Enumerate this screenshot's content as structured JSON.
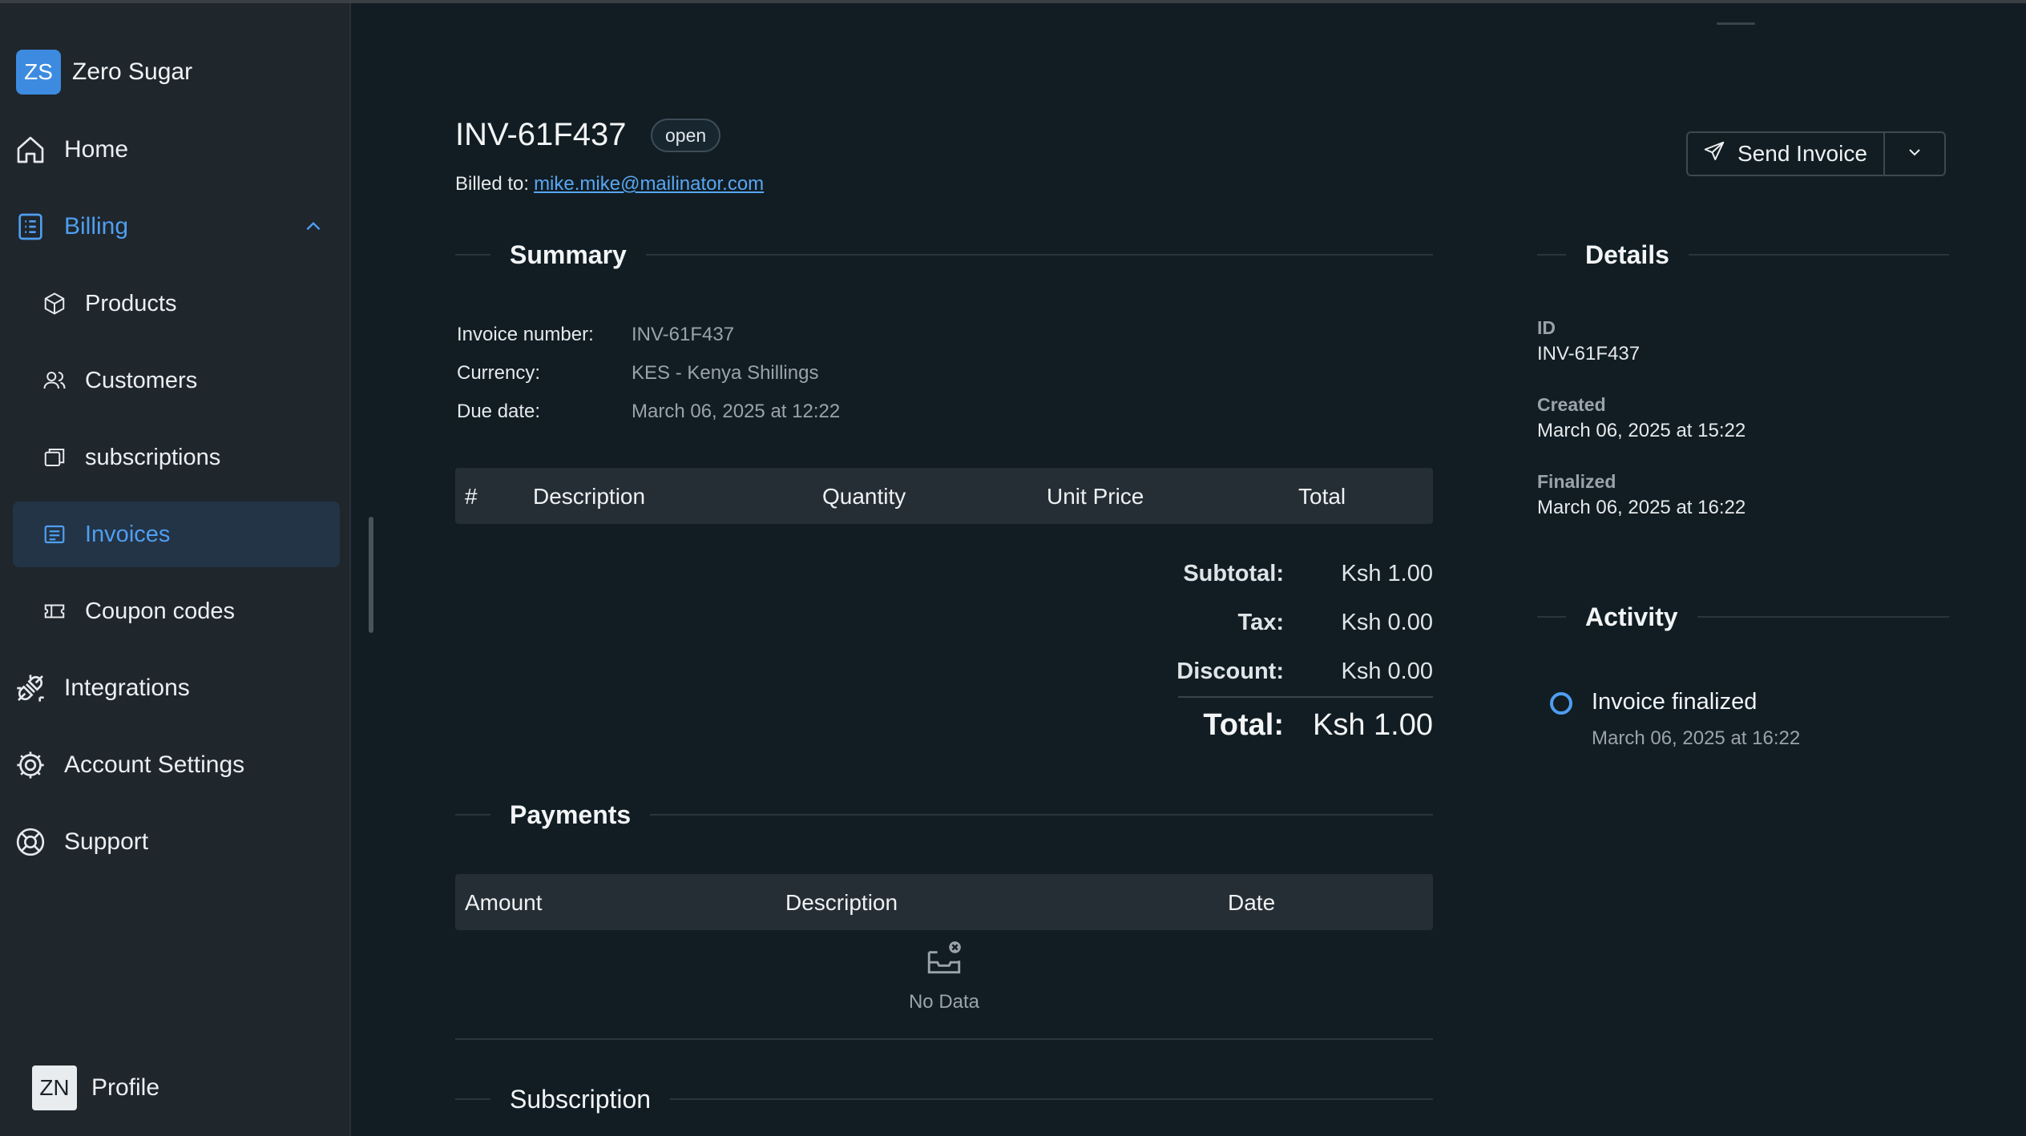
{
  "org": {
    "initials": "ZS",
    "name": "Zero Sugar"
  },
  "nav": {
    "home": "Home",
    "billing": "Billing",
    "billing_children": {
      "products": "Products",
      "customers": "Customers",
      "subscriptions": "subscriptions",
      "invoices": "Invoices",
      "coupon_codes": "Coupon codes"
    },
    "integrations": "Integrations",
    "account_settings": "Account Settings",
    "support": "Support"
  },
  "profile": {
    "initials": "ZN",
    "label": "Profile"
  },
  "invoice": {
    "title": "INV-61F437",
    "status": "open",
    "billed_to_label": "Billed to:",
    "billed_to_email": "mike.mike@mailinator.com"
  },
  "actions": {
    "send_invoice": "Send Invoice"
  },
  "summary": {
    "heading": "Summary",
    "fields": [
      {
        "label": "Invoice number:",
        "value": "INV-61F437"
      },
      {
        "label": "Currency:",
        "value": "KES - Kenya Shillings"
      },
      {
        "label": "Due date:",
        "value": "March 06, 2025 at 12:22"
      }
    ],
    "columns": [
      "#",
      "Description",
      "Quantity",
      "Unit Price",
      "Total"
    ],
    "totals": {
      "subtotal_label": "Subtotal:",
      "subtotal": "Ksh 1.00",
      "tax_label": "Tax:",
      "tax": "Ksh 0.00",
      "discount_label": "Discount:",
      "discount": "Ksh 0.00",
      "total_label": "Total:",
      "total": "Ksh 1.00"
    }
  },
  "payments": {
    "heading": "Payments",
    "columns": [
      "Amount",
      "Description",
      "Date"
    ],
    "empty": "No Data"
  },
  "subscription": {
    "heading": "Subscription"
  },
  "details": {
    "heading": "Details",
    "items": [
      {
        "label": "ID",
        "value": "INV-61F437"
      },
      {
        "label": "Created",
        "value": "March 06, 2025 at 15:22"
      },
      {
        "label": "Finalized",
        "value": "March 06, 2025 at 16:22"
      }
    ]
  },
  "activity": {
    "heading": "Activity",
    "events": [
      {
        "title": "Invoice finalized",
        "time": "March 06, 2025 at 16:22"
      }
    ]
  },
  "colors": {
    "accent": "#4f9ef0",
    "sidebar_bg": "#1f262c",
    "main_bg": "#111d23",
    "selected_bg": "#233446"
  }
}
